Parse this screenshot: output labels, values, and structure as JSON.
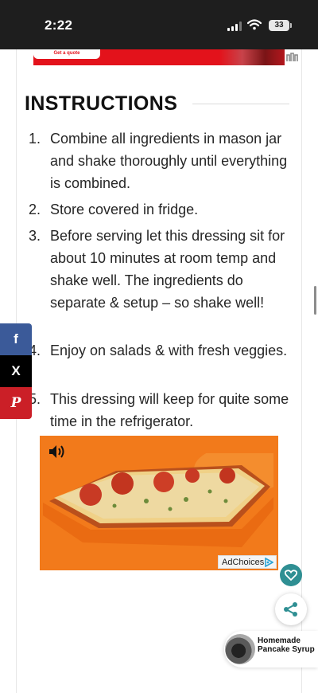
{
  "status_bar": {
    "time": "2:22",
    "battery": "33"
  },
  "ad_banner": {
    "cta": "Get a quote"
  },
  "instructions": {
    "title": "INSTRUCTIONS",
    "steps": [
      {
        "num": "1.",
        "text": "Combine all ingredients in mason jar and shake thoroughly until everything is combined."
      },
      {
        "num": "2.",
        "text": "Store covered in fridge."
      },
      {
        "num": "3.",
        "text": "Before serving let this dressing sit for about 10 minutes at room temp and shake well. The ingredients do separate & setup – so shake well!"
      },
      {
        "num": "4.",
        "text": "Enjoy on salads & with fresh veggies."
      },
      {
        "num": "5.",
        "text": "This dressing will keep for quite some time in the refrigerator."
      }
    ]
  },
  "share_rail": {
    "facebook": "f",
    "x": "X",
    "pinterest": "P"
  },
  "video_ad": {
    "adchoices": "AdChoices"
  },
  "related": {
    "title": "Homemade Pancake Syrup"
  },
  "colors": {
    "accent_teal": "#2f8f93",
    "ad_red": "#e3121b",
    "facebook": "#3b5a99",
    "pinterest": "#cb1f27"
  },
  "icons": [
    "signal-icon",
    "wifi-icon",
    "battery-icon",
    "speaker-icon",
    "adchoices-icon",
    "heart-icon",
    "share-icon"
  ]
}
